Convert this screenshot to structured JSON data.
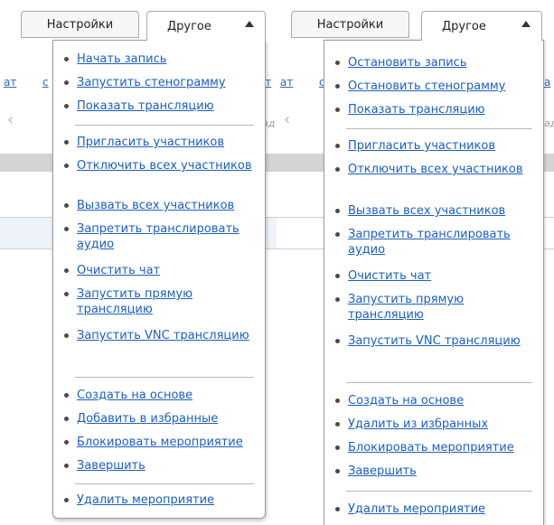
{
  "tabs": {
    "settings": "Настройки",
    "other": "Другое"
  },
  "background": {
    "left_fragments": [
      "ат",
      "с",
      "ат",
      "ад"
    ],
    "right_fragments": [
      "ат",
      "с",
      "а",
      "ад"
    ]
  },
  "left_menu": {
    "group1": [
      "Начать запись",
      "Запустить стенограмму",
      "Показать трансляцию"
    ],
    "group2": [
      "Пригласить участников",
      "Отключить всех участников",
      "Вызвать всех участников",
      "Запретить транслировать аудио",
      "Очистить чат",
      "Запустить прямую трансляцию",
      "Запустить VNC трансляцию"
    ],
    "group3": [
      "Создать на основе",
      "Добавить в избранные",
      "Блокировать мероприятие",
      "Завершить"
    ],
    "group4": [
      "Удалить мероприятие"
    ]
  },
  "right_menu": {
    "group1": [
      "Остановить запись",
      "Остановить стенограмму",
      "Показать трансляцию"
    ],
    "group2": [
      "Пригласить участников",
      "Отключить всех участников",
      "Вызвать всех участников",
      "Запретить транслировать аудио",
      "Очистить чат",
      "Запустить прямую трансляцию",
      "Запустить VNC трансляцию"
    ],
    "group3": [
      "Создать на основе",
      "Удалить из избранных",
      "Блокировать мероприятие",
      "Завершить"
    ],
    "group4": [
      "Удалить мероприятие"
    ]
  },
  "icons": {
    "collapse": "triangle-up-icon",
    "nav_back": "chevron-left-icon"
  },
  "colors": {
    "link": "#1a5ec8",
    "bg_link": "#2a67c9",
    "border": "#9d9d9d",
    "band": "#d4d4d4"
  }
}
